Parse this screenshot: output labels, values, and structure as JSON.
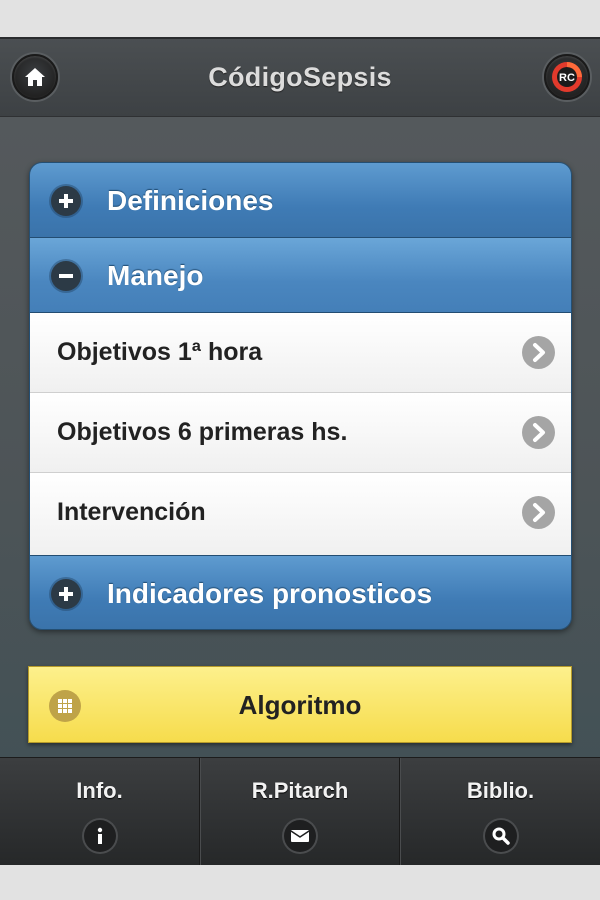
{
  "header": {
    "title": "CódigoSepsis",
    "home_icon": "home-icon",
    "logo_icon": "rc-logo-icon",
    "logo_text": "RC"
  },
  "collapsibles": [
    {
      "label": "Definiciones",
      "state": "collapsed",
      "icon": "plus-icon"
    },
    {
      "label": "Manejo",
      "state": "expanded",
      "icon": "minus-icon",
      "items": [
        {
          "label": "Objetivos 1ª hora",
          "icon": "chevron-right-icon"
        },
        {
          "label": "Objetivos 6 primeras hs.",
          "icon": "chevron-right-icon"
        },
        {
          "label": "Intervención",
          "icon": "chevron-right-icon"
        }
      ]
    },
    {
      "label": "Indicadores pronosticos",
      "state": "collapsed",
      "icon": "plus-icon"
    }
  ],
  "algo_button": {
    "label": "Algoritmo",
    "icon": "grid-icon"
  },
  "footer": {
    "tabs": [
      {
        "label": "Info.",
        "icon": "info-icon"
      },
      {
        "label": "R.Pitarch",
        "icon": "mail-icon"
      },
      {
        "label": "Biblio.",
        "icon": "search-icon"
      }
    ]
  },
  "colors": {
    "header_bg": "#3f4346",
    "accordion_blue": "#4a86bf",
    "algo_yellow": "#f6dc4c",
    "footer_bg": "#2f3133"
  }
}
